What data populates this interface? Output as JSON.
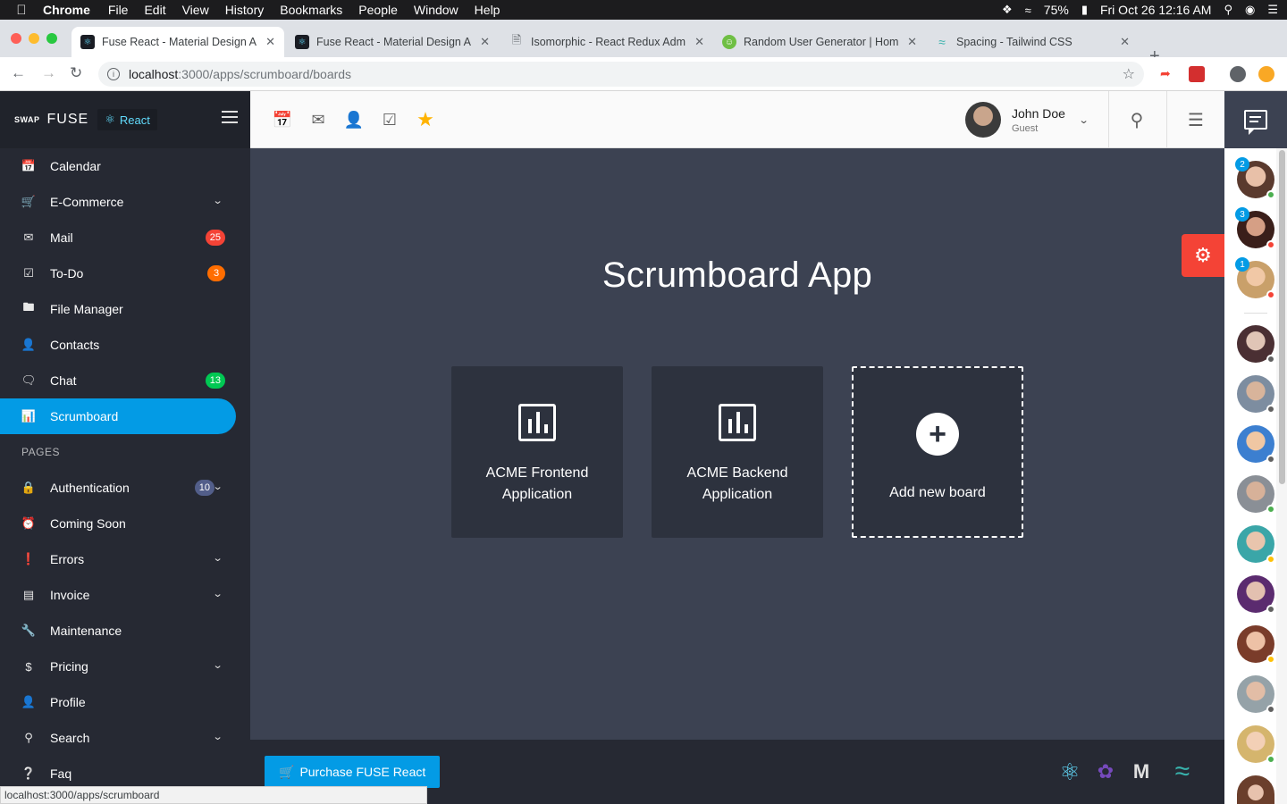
{
  "os_menubar": {
    "app": "Chrome",
    "menus": [
      "File",
      "Edit",
      "View",
      "History",
      "Bookmarks",
      "People",
      "Window",
      "Help"
    ],
    "battery": "75%",
    "clock": "Fri Oct 26  12:16 AM"
  },
  "browser": {
    "tabs": [
      {
        "title": "Fuse React - Material Design A"
      },
      {
        "title": "Fuse React - Material Design A"
      },
      {
        "title": "Isomorphic - React Redux Adm"
      },
      {
        "title": "Random User Generator | Hom"
      },
      {
        "title": "Spacing - Tailwind CSS"
      }
    ],
    "url_host": "localhost",
    "url_path": ":3000/apps/scrumboard/boards",
    "status_url": "localhost:3000/apps/scrumboard"
  },
  "sidebar": {
    "logo_text": "SWAP",
    "brand": "FUSE",
    "react_tag": "React",
    "items": [
      {
        "label": "Calendar",
        "icon": "calendar-icon"
      },
      {
        "label": "E-Commerce",
        "icon": "cart-icon"
      },
      {
        "label": "Mail",
        "icon": "mail-icon",
        "badge": "25"
      },
      {
        "label": "To-Do",
        "icon": "checkbox-icon",
        "badge": "3"
      },
      {
        "label": "File Manager",
        "icon": "folder-icon"
      },
      {
        "label": "Contacts",
        "icon": "contact-card-icon"
      },
      {
        "label": "Chat",
        "icon": "chat-icon",
        "badge": "13"
      },
      {
        "label": "Scrumboard",
        "icon": "assessment-icon"
      }
    ],
    "pages_header": "PAGES",
    "pages": [
      {
        "label": "Authentication",
        "icon": "lock-icon",
        "badge": "10"
      },
      {
        "label": "Coming Soon",
        "icon": "alarm-icon"
      },
      {
        "label": "Errors",
        "icon": "error-icon"
      },
      {
        "label": "Invoice",
        "icon": "receipt-icon"
      },
      {
        "label": "Maintenance",
        "icon": "wrench-icon"
      },
      {
        "label": "Pricing",
        "icon": "dollar-icon"
      },
      {
        "label": "Profile",
        "icon": "person-icon"
      },
      {
        "label": "Search",
        "icon": "search-icon"
      },
      {
        "label": "Faq",
        "icon": "help-icon"
      }
    ]
  },
  "badge_colors": {
    "mail": "#f44336",
    "todo": "#ff6d00",
    "chat": "#00c853",
    "auth": "#525e8a"
  },
  "toolbar": {
    "shortcuts": [
      "calendar-icon",
      "mail-icon",
      "contact-icon",
      "checkbox-icon",
      "star-icon"
    ],
    "user": {
      "name": "John Doe",
      "role": "Guest"
    }
  },
  "main": {
    "title": "Scrumboard App",
    "boards": [
      {
        "name": "ACME Frontend Application"
      },
      {
        "name": "ACME Backend Application"
      }
    ],
    "add_board": "Add new board"
  },
  "chat_contacts": {
    "unread": [
      "2",
      "3",
      "1"
    ]
  },
  "footer": {
    "purchase": "Purchase FUSE React",
    "tech": [
      "react-icon",
      "redux-icon",
      "material-ui-icon",
      "tailwind-icon"
    ]
  },
  "colors": {
    "accent": "#039be5",
    "sidebar_bg": "#262933",
    "main_bg": "#3c4252",
    "card_bg": "#2d323e",
    "settings_fab": "#f44336"
  }
}
